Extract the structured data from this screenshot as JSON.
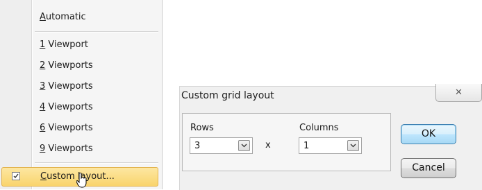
{
  "menu": {
    "items": [
      {
        "label": "Automatic"
      },
      {
        "label": "1 Viewport"
      },
      {
        "label": "2 Viewports"
      },
      {
        "label": "3 Viewports"
      },
      {
        "label": "4 Viewports"
      },
      {
        "label": "6 Viewports"
      },
      {
        "label": "9 Viewports"
      },
      {
        "label": "Custom layout...",
        "checked": true,
        "highlighted": true
      }
    ],
    "highlight_color": "#f9d46c"
  },
  "dialog": {
    "title": "Custom grid layout",
    "close_symbol": "✕",
    "rows_label": "Rows",
    "rows_value": "3",
    "times_symbol": "x",
    "columns_label": "Columns",
    "columns_value": "1",
    "ok_label": "OK",
    "cancel_label": "Cancel"
  },
  "icons": {
    "checkbox": "checkmark-icon",
    "dropdown": "chevron-down-icon",
    "cursor": "hand-cursor-icon"
  }
}
